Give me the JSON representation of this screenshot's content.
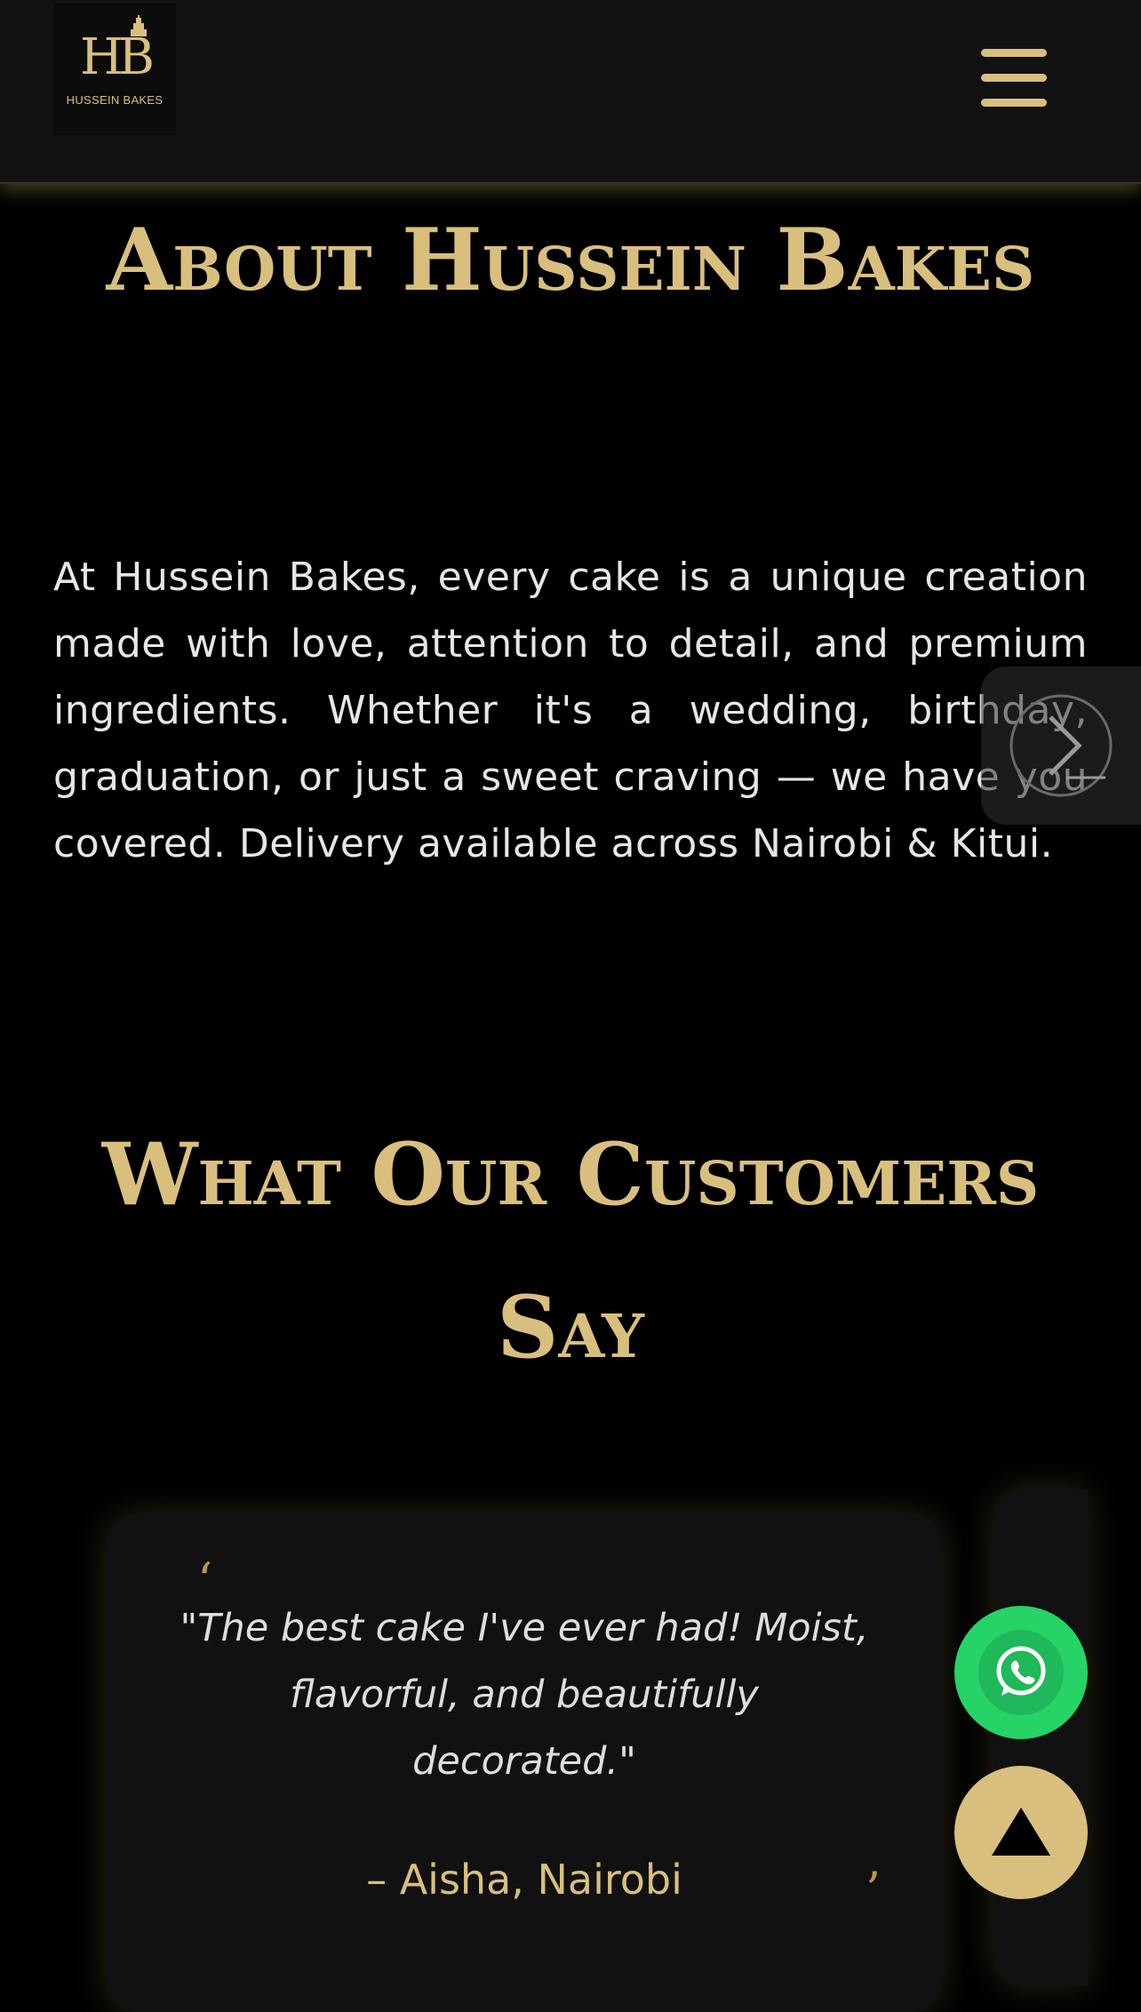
{
  "header": {
    "logo": {
      "monogram": "HB",
      "name": "HUSSEIN BAKES"
    },
    "menu_icon": "hamburger-menu-icon"
  },
  "about": {
    "title": "About Hussein Bakes",
    "body": "At Hussein Bakes, every cake is a unique creation made with love, attention to detail, and premium ingredients. Whether it's a wedding, birthday, graduation, or just a sweet craving — we have you covered. Delivery available across Nairobi & Kitui."
  },
  "slider": {
    "next_icon": "chevron-right-icon"
  },
  "testimonials": {
    "title": "What Our Customers Say",
    "items": [
      {
        "quote": "\"The best cake I've ever had! Moist, flavorful, and beautifully decorated.\"",
        "author": "– Aisha, Nairobi"
      }
    ],
    "open_mark": "‘",
    "close_mark": "’"
  },
  "floating": {
    "whatsapp_icon": "whatsapp-icon",
    "scroll_top_icon": "arrow-up-icon"
  },
  "colors": {
    "gold": "#d9bf7e",
    "header_bg": "#121212",
    "page_bg": "#000000",
    "whatsapp_green": "#25d366"
  }
}
